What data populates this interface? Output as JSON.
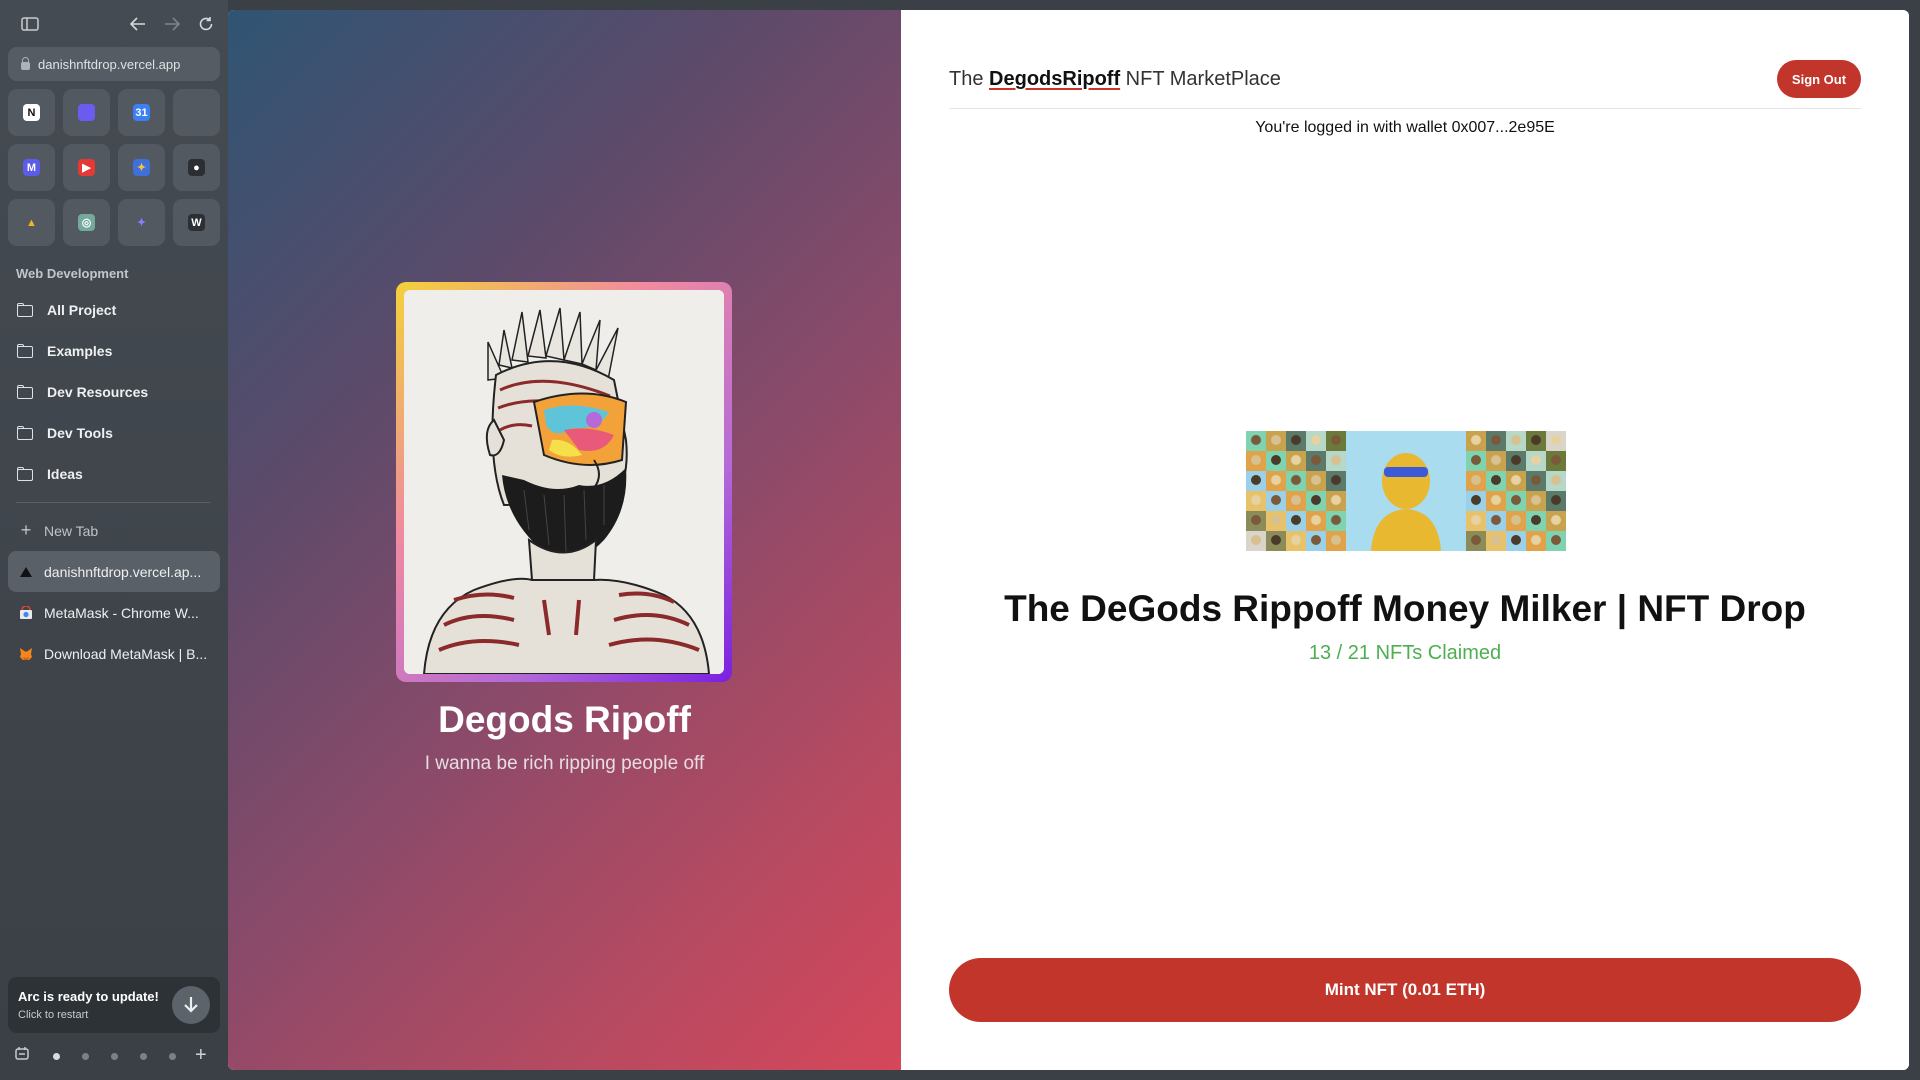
{
  "browser": {
    "url": "danishnftdrop.vercel.app",
    "favorites": [
      {
        "icon": "notion-icon",
        "glyph": "N",
        "bg": "#ffffff",
        "fg": "#111111"
      },
      {
        "icon": "linear-icon",
        "glyph": "",
        "bg": "#6b5cf0",
        "fg": "#ffffff"
      },
      {
        "icon": "calendar-icon",
        "glyph": "31",
        "bg": "#3b7ff2",
        "fg": "#ffffff"
      },
      {
        "icon": "empty-slot-icon",
        "glyph": "",
        "bg": "transparent",
        "fg": "#ffffff"
      },
      {
        "icon": "mail-icon",
        "glyph": "M",
        "bg": "#5b5ce8",
        "fg": "#ffffff"
      },
      {
        "icon": "youtube-icon",
        "glyph": "▶",
        "bg": "#e53935",
        "fg": "#ffffff"
      },
      {
        "icon": "figma-icon",
        "glyph": "✦",
        "bg": "#3f6fd8",
        "fg": "#f5c23b"
      },
      {
        "icon": "github-icon",
        "glyph": "●",
        "bg": "#2b2f33",
        "fg": "#ffffff"
      },
      {
        "icon": "google-drive-icon",
        "glyph": "▲",
        "bg": "transparent",
        "fg": "#f3b51c"
      },
      {
        "icon": "chatgpt-icon",
        "glyph": "◎",
        "bg": "#74aa9c",
        "fg": "#ffffff"
      },
      {
        "icon": "gemini-icon",
        "glyph": "✦",
        "bg": "transparent",
        "fg": "#8f7bff"
      },
      {
        "icon": "wordpad-icon",
        "glyph": "W",
        "bg": "#2c3035",
        "fg": "#ffffff"
      }
    ],
    "section_label": "Web Development",
    "folders": [
      "All Project",
      "Examples",
      "Dev Resources",
      "Dev Tools",
      "Ideas"
    ],
    "new_tab_label": "New Tab",
    "tabs": [
      {
        "label": "danishnftdrop.vercel.ap...",
        "icon": "vercel-icon",
        "active": true
      },
      {
        "label": "MetaMask - Chrome W...",
        "icon": "chrome-web-store-icon",
        "active": false
      },
      {
        "label": "Download MetaMask | B...",
        "icon": "metamask-icon",
        "active": false
      }
    ],
    "update": {
      "title": "Arc is ready to update!",
      "subtitle": "Click to restart"
    }
  },
  "page": {
    "collection_name": "Degods Ripoff",
    "collection_description": "I wanna be rich ripping people off",
    "brand_prefix": "The ",
    "brand_strong": "DegodsRipoff",
    "brand_suffix": " NFT MarketPlace",
    "sign_out_label": "Sign Out",
    "wallet_text": "You're logged in with wallet 0x007...2e95E",
    "drop_title": "The DeGods Rippoff Money Milker | NFT Drop",
    "claimed_text": "13 / 21 NFTs Claimed",
    "mint_label": "Mint NFT (0.01 ETH)"
  },
  "colors": {
    "accent_red": "#c1352b",
    "claimed_green": "#4caf50"
  }
}
